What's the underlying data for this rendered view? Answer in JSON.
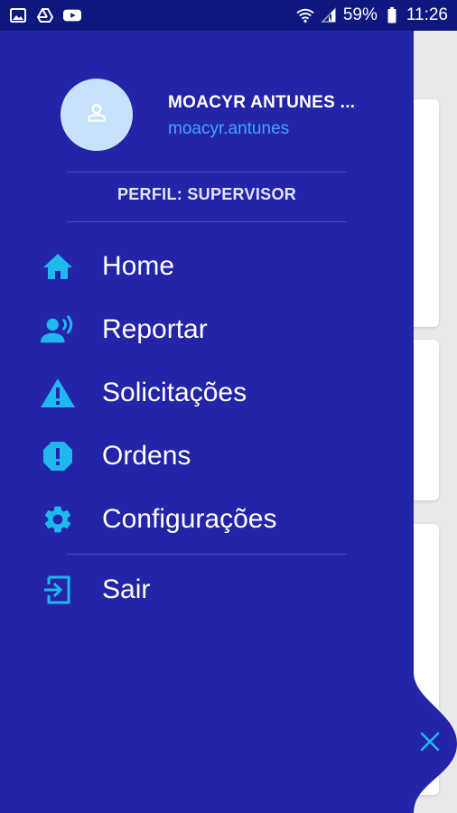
{
  "status_bar": {
    "battery_percent": "59%",
    "time": "11:26",
    "left_icons": [
      "image-icon",
      "drive-icon",
      "youtube-icon"
    ],
    "right_icons": [
      "wifi-icon",
      "signal-icon",
      "battery-icon"
    ]
  },
  "drawer": {
    "user": {
      "name": "MOACYR ANTUNES ...",
      "login": "moacyr.antunes",
      "avatar_icon": "user-icon"
    },
    "profile_label": "PERFIL: SUPERVISOR",
    "menu": [
      {
        "label": "Home",
        "icon": "home-icon"
      },
      {
        "label": "Reportar",
        "icon": "report-voice-icon"
      },
      {
        "label": "Solicitações",
        "icon": "warning-icon"
      },
      {
        "label": "Ordens",
        "icon": "alert-octagon-icon"
      },
      {
        "label": "Configurações",
        "icon": "gear-icon"
      }
    ],
    "logout": {
      "label": "Sair",
      "icon": "exit-icon"
    }
  },
  "colors": {
    "drawer_bg": "#2424a8",
    "status_bar_bg": "#0e1780",
    "accent_icon": "#1fb8ee",
    "login_text": "#3fa5ff",
    "avatar_bg": "#c9e2fb"
  }
}
